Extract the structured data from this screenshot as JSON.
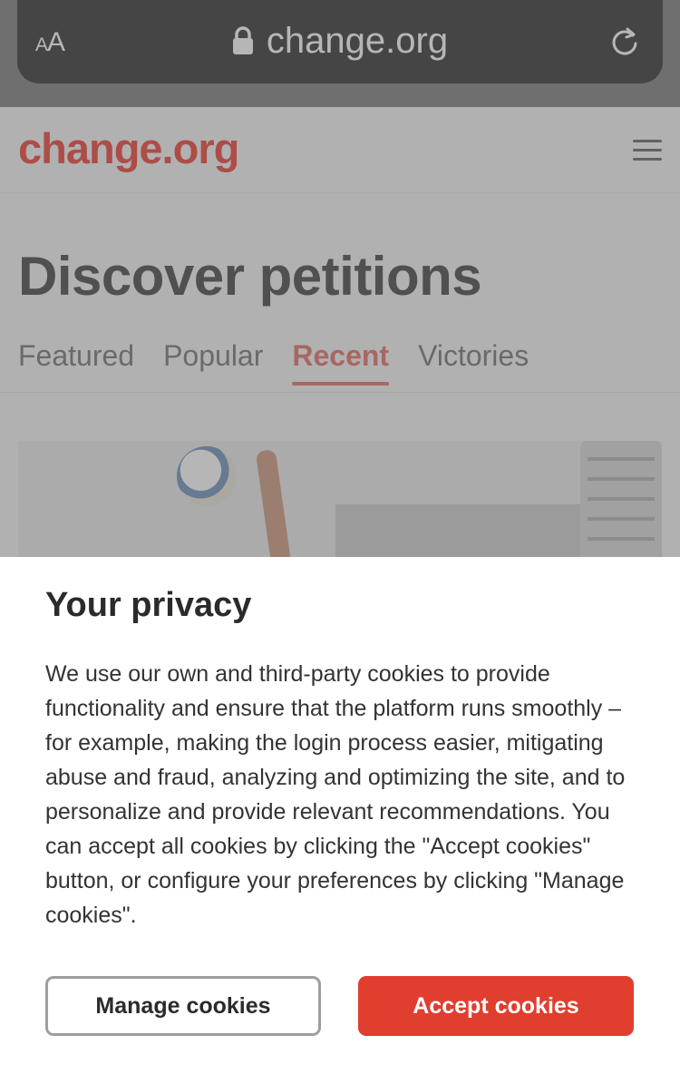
{
  "browser": {
    "text_size_label": "AA",
    "url": "change.org"
  },
  "site": {
    "logo": "change.org",
    "page_title": "Discover petitions",
    "tabs": [
      {
        "label": "Featured",
        "active": false
      },
      {
        "label": "Popular",
        "active": false
      },
      {
        "label": "Recent",
        "active": true
      },
      {
        "label": "Victories",
        "active": false
      }
    ]
  },
  "privacy": {
    "title": "Your privacy",
    "body": "We use our own and third-party cookies to provide functionality and ensure that the platform runs smoothly – for example, making the login process easier, mitigating abuse and fraud, analyzing and optimizing the site, and to personalize and provide relevant recommendations. You can accept all cookies by clicking the \"Accept cookies\" button, or configure your preferences by clicking \"Manage cookies\".",
    "manage_label": "Manage cookies",
    "accept_label": "Accept cookies"
  },
  "colors": {
    "brand": "#ec2c22",
    "accept_button": "#e03e2f",
    "browser_bar": "#1c1c1e"
  },
  "icons": [
    "text-size-icon",
    "lock-icon",
    "reload-icon",
    "hamburger-menu-icon"
  ]
}
